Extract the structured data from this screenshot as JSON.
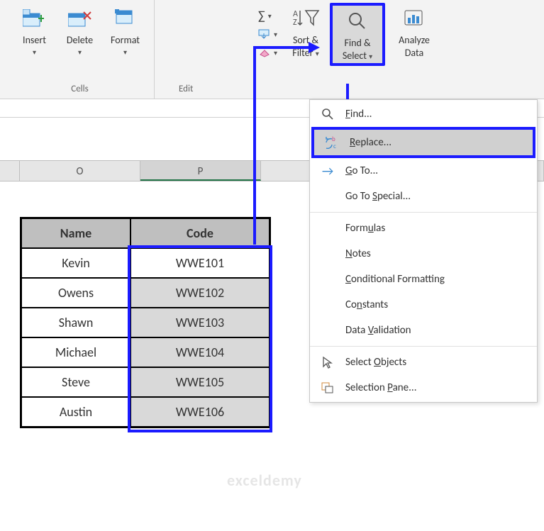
{
  "ribbon": {
    "cells_group_label": "Cells",
    "edit_group_label": "Edit",
    "insert_label": "Insert",
    "delete_label": "Delete",
    "format_label": "Format",
    "sort_filter_label": "Sort & Filter",
    "find_select_label": "Find & Select",
    "analyze_data_label": "Analyze Data"
  },
  "menu": {
    "find": "Find...",
    "replace": "Replace...",
    "goto": "Go To...",
    "goto_special": "Go To Special...",
    "formulas": "Formulas",
    "notes": "Notes",
    "cond_fmt": "Conditional Formatting",
    "constants": "Constants",
    "data_val": "Data Validation",
    "select_objects": "Select Objects",
    "selection_pane": "Selection Pane..."
  },
  "columns": {
    "O": "O",
    "P": "P"
  },
  "table": {
    "headers": {
      "name": "Name",
      "code": "Code"
    },
    "rows": [
      {
        "name": "Kevin",
        "code": "WWE101"
      },
      {
        "name": "Owens",
        "code": "WWE102"
      },
      {
        "name": "Shawn",
        "code": "WWE103"
      },
      {
        "name": "Michael",
        "code": "WWE104"
      },
      {
        "name": "Steve",
        "code": "WWE105"
      },
      {
        "name": "Austin",
        "code": "WWE106"
      }
    ]
  },
  "watermark": "exceldemy"
}
